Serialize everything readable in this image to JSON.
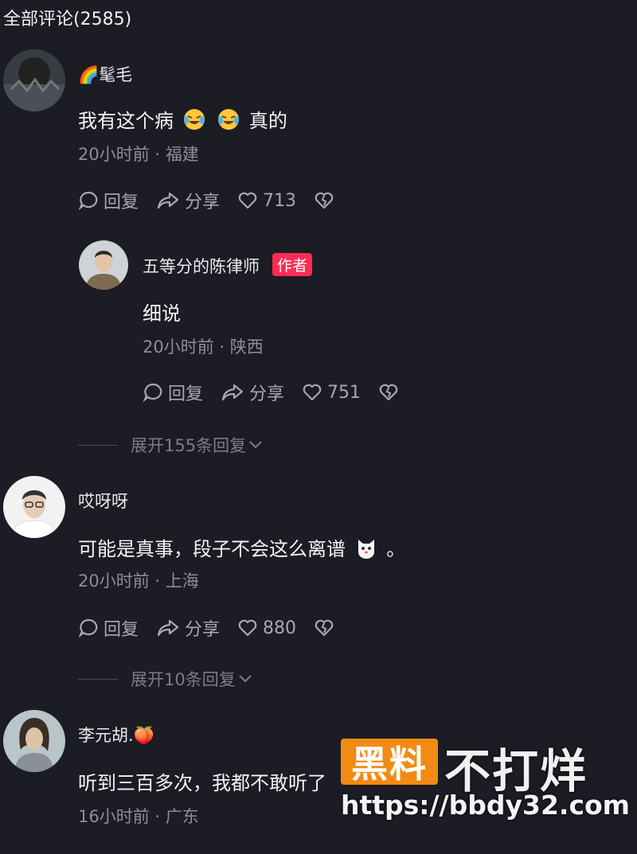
{
  "header": {
    "title": "全部评论(2585)"
  },
  "comments": [
    {
      "username": "🌈髦毛",
      "text": "我有这个病",
      "text_tail": "真的",
      "meta": "20小时前 · 福建",
      "reply_label": "回复",
      "share_label": "分享",
      "likes": "713"
    },
    {
      "username": "五等分的陈律师",
      "tag": "作者",
      "text": "细说",
      "meta": "20小时前 · 陕西",
      "reply_label": "回复",
      "share_label": "分享",
      "likes": "751"
    },
    {
      "username": "哎呀呀",
      "text": "可能是真事，段子不会这么离谱",
      "text_tail": "。",
      "meta": "20小时前 · 上海",
      "reply_label": "回复",
      "share_label": "分享",
      "likes": "880"
    },
    {
      "username": "李元胡.🍑",
      "text": "听到三百多次，我都不敢听了",
      "meta": "16小时前 · 广东"
    }
  ],
  "expand": [
    {
      "label": "展开155条回复"
    },
    {
      "label": "展开10条回复"
    }
  ],
  "watermark": {
    "box_text": "黑料",
    "text": "不打烊",
    "url": "https://bbdy32.com"
  },
  "colors": {
    "background": "#1b1c24",
    "author_tag": "#fe2c55",
    "watermark_orange": "#f28b14"
  }
}
